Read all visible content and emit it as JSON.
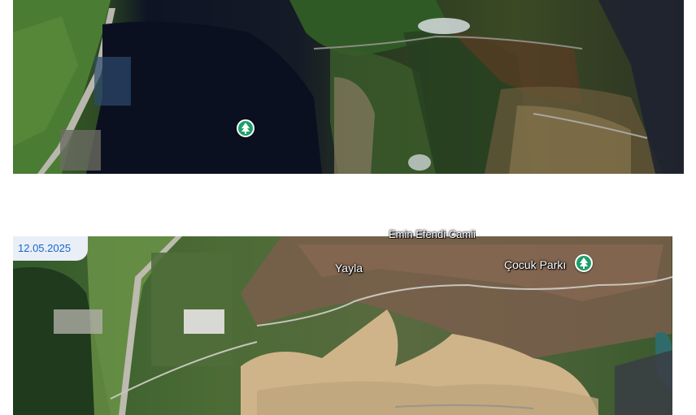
{
  "panels": {
    "top": {
      "imagery": "satellite-view",
      "pin_icon": "tree-pin-icon"
    },
    "bottom": {
      "imagery": "satellite-view",
      "date": "12.05.2025",
      "labels": {
        "yayla": "Yayla",
        "mosque": "Emin Efendi Camii",
        "park": "Çocuk Parkı"
      },
      "pin_icon": "tree-pin-icon"
    }
  },
  "colors": {
    "pin": "#1e9e6a",
    "date_text": "#1a66cc",
    "date_badge_bg": "#e9eef7"
  }
}
